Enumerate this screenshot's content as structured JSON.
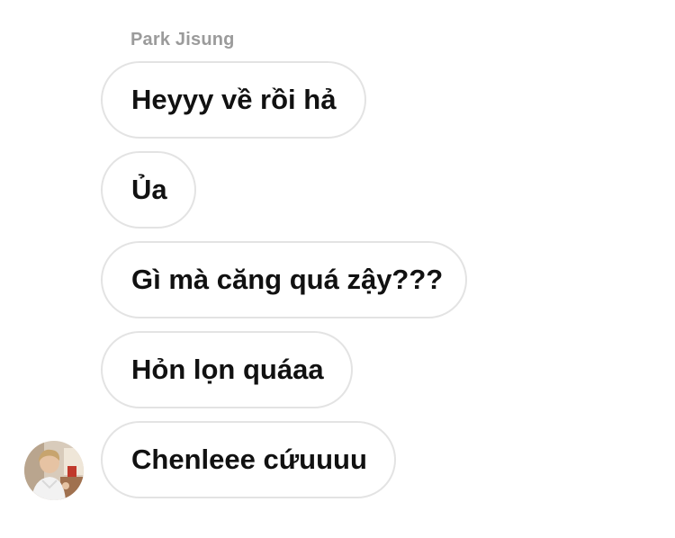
{
  "chat": {
    "sender_name": "Park Jisung",
    "messages": [
      {
        "text": "Heyyy về rồi hả"
      },
      {
        "text": "Ủa"
      },
      {
        "text": "Gì mà căng quá zậy???"
      },
      {
        "text": "Hỏn lọn quáaa"
      },
      {
        "text": "Chenleee cứuuuu"
      }
    ],
    "avatar": {
      "icon": "user-avatar-photo"
    }
  }
}
